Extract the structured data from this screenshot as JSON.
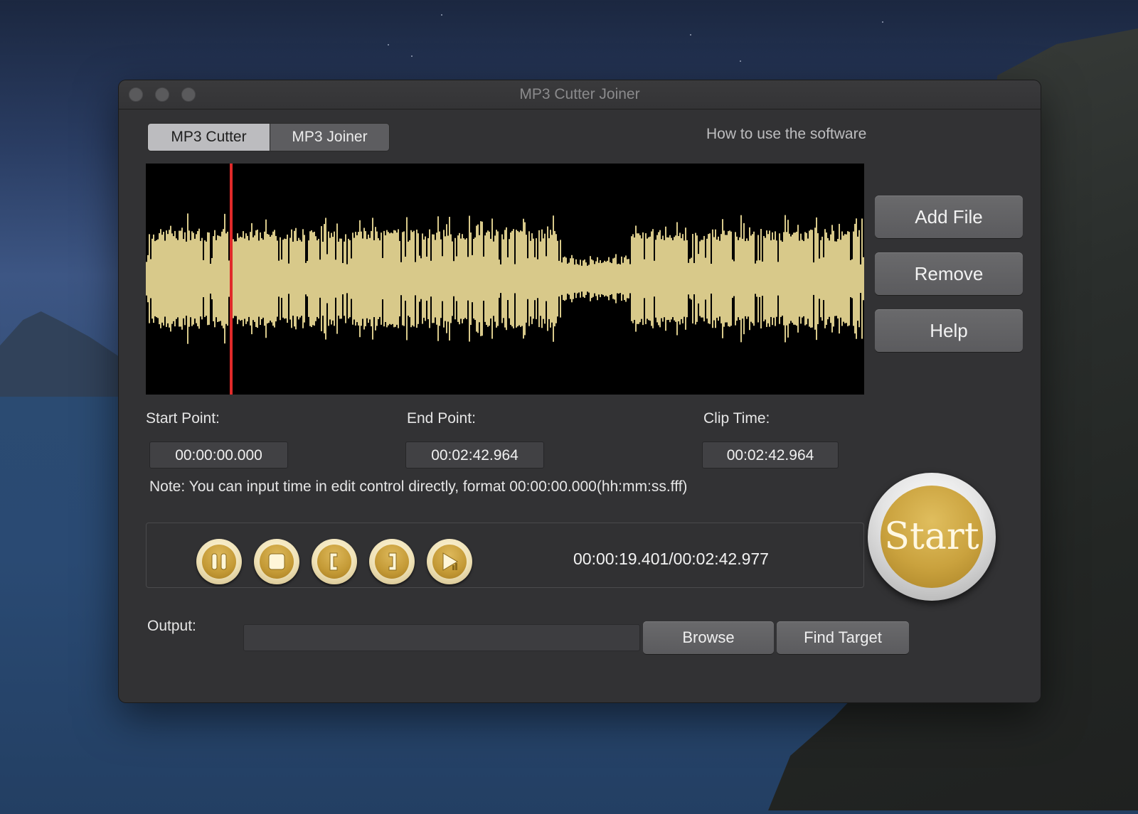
{
  "window": {
    "title": "MP3 Cutter Joiner"
  },
  "tabs": [
    {
      "label": "MP3 Cutter",
      "active": true
    },
    {
      "label": "MP3 Joiner",
      "active": false
    }
  ],
  "help_link": "How to use the software",
  "side_buttons": {
    "add_file": "Add File",
    "remove": "Remove",
    "help": "Help"
  },
  "fields": {
    "start_point": {
      "label": "Start Point:",
      "value": "00:00:00.000"
    },
    "end_point": {
      "label": "End Point:",
      "value": "00:02:42.964"
    },
    "clip_time": {
      "label": "Clip Time:",
      "value": "00:02:42.964"
    }
  },
  "note": "Note: You can input time in edit control directly, format 00:00:00.000(hh:mm:ss.fff)",
  "player": {
    "controls": [
      "pause-icon",
      "stop-icon",
      "mark-start-icon",
      "mark-end-icon",
      "play-selection-icon"
    ],
    "position_readout": "00:00:19.401/00:02:42.977",
    "playhead_fraction": 0.119
  },
  "start_button": "Start",
  "output": {
    "label": "Output:",
    "value": "",
    "browse": "Browse",
    "find_target": "Find Target"
  },
  "colors": {
    "waveform": "#d8c98a",
    "playhead": "#e02a2a",
    "gold": "#c9a13c"
  }
}
